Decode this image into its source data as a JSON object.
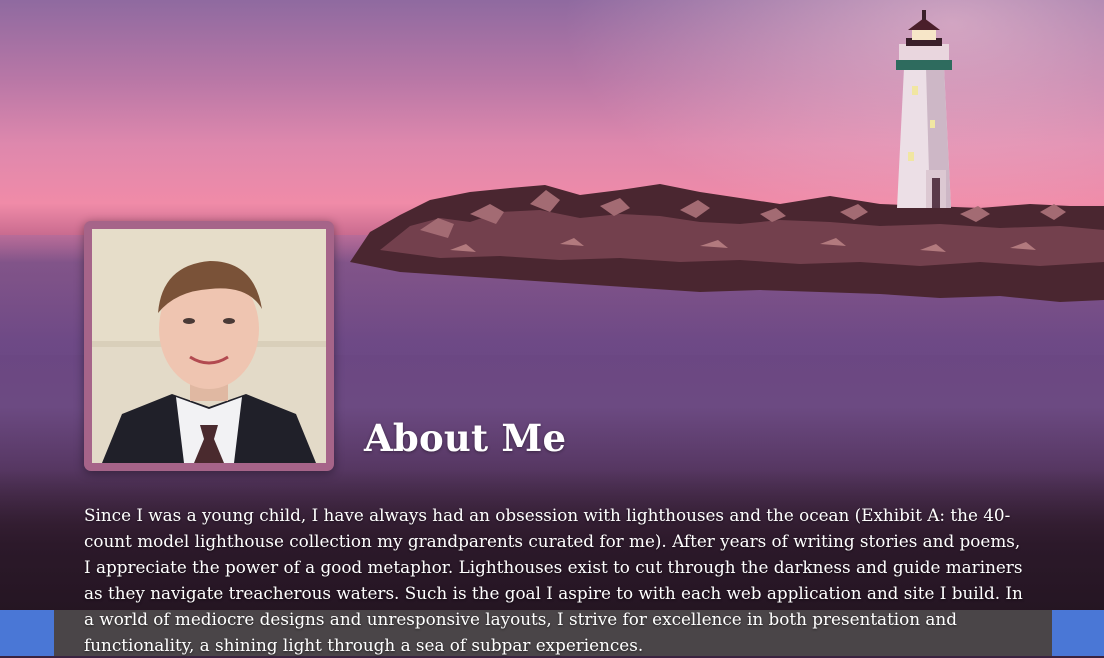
{
  "about": {
    "heading": "About Me",
    "bio": "Since I was a young child, I have always had an obsession with lighthouses and the ocean (Exhibit A: the 40-count model lighthouse collection my grandparents curated for me). After years of writing stories and poems, I appreciate the power of a good metaphor. Lighthouses exist to cut through the darkness and guide mariners as they navigate treacherous waters. Such is the goal I aspire to with each web application and site I build. In a world of mediocre designs and unresponsive layouts, I strive for excellence in both presentation and functionality, a shining light through a sea of subpar experiences."
  },
  "icons": {
    "hero": "lighthouse-hero-image",
    "portrait": "profile-photo"
  },
  "colors": {
    "photo_frame": "#a66489",
    "footer_accent": "#4a77d6",
    "footer_panel": "#4a4548",
    "text": "#ffffff"
  }
}
